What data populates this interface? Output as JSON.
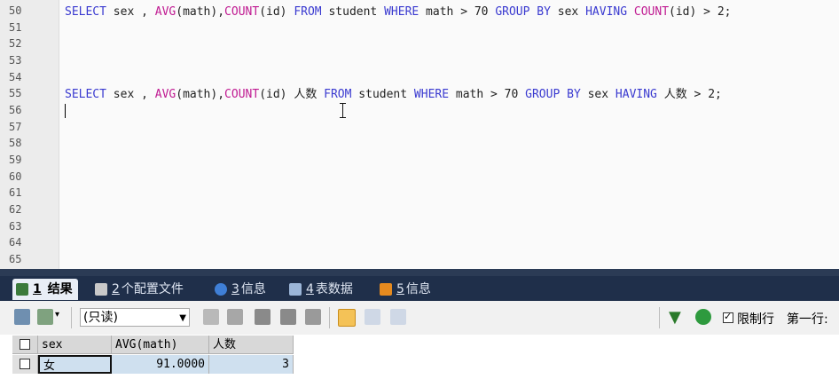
{
  "editor": {
    "line_numbers": [
      "50",
      "51",
      "52",
      "53",
      "54",
      "55",
      "56",
      "57",
      "58",
      "59",
      "60",
      "61",
      "62",
      "63",
      "64",
      "65"
    ],
    "line50": {
      "t1": "SELECT",
      "t2": " sex , ",
      "t3": "AVG",
      "t4": "(math),",
      "t5": "COUNT",
      "t6": "(id) ",
      "t7": "FROM",
      "t8": " student ",
      "t9": "WHERE",
      "t10": " math > 70 ",
      "t11": "GROUP BY",
      "t12": " sex ",
      "t13": "HAVING",
      "t14": " ",
      "t15": "COUNT",
      "t16": "(id) > 2;"
    },
    "line55": {
      "t1": "SELECT",
      "t2": " sex , ",
      "t3": "AVG",
      "t4": "(math),",
      "t5": "COUNT",
      "t6": "(id) 人数 ",
      "t7": "FROM",
      "t8": " student ",
      "t9": "WHERE",
      "t10": " math > 70 ",
      "t11": "GROUP BY",
      "t12": " sex ",
      "t13": "HAVING",
      "t14": " 人数 > 2;"
    }
  },
  "tabs": [
    {
      "num": "1",
      "label": "结果",
      "icon": "table-result-icon"
    },
    {
      "num": "2",
      "label": "个配置文件",
      "icon": "profile-icon"
    },
    {
      "num": "3",
      "label": "信息",
      "icon": "info-icon"
    },
    {
      "num": "4",
      "label": "表数据",
      "icon": "table-data-icon"
    },
    {
      "num": "5",
      "label": "信息",
      "icon": "info-alt-icon"
    }
  ],
  "toolbar": {
    "mode_select": "(只读)",
    "limit_rows_label": "限制行",
    "first_row_label": "第一行:"
  },
  "result": {
    "columns": [
      "sex",
      "AVG(math)",
      "人数"
    ],
    "rows": [
      [
        "女",
        "91.0000",
        "3"
      ]
    ]
  },
  "colors": {
    "keyword": "#3a3ad0",
    "function": "#c01b92",
    "tabbar": "#1f2f4a"
  }
}
